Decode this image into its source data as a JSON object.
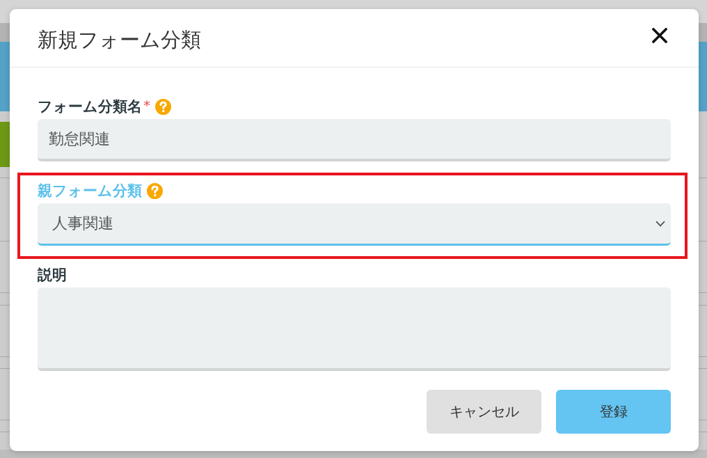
{
  "dialog": {
    "title": "新規フォーム分類"
  },
  "fields": [
    {
      "kind": "text",
      "label": "フォーム分類名",
      "required_mark": "*",
      "help": true,
      "value": "勤怠関連",
      "focused": false,
      "highlighted": false
    },
    {
      "kind": "select",
      "label": "親フォーム分類",
      "help": true,
      "value": "人事関連",
      "focused": true,
      "highlighted": true
    },
    {
      "kind": "textarea",
      "label": "説明",
      "help": false,
      "focused": false,
      "highlighted": false
    }
  ],
  "buttons": [
    {
      "kind": "cancel",
      "label": "キャンセル"
    },
    {
      "kind": "submit",
      "label": "登録"
    }
  ]
}
